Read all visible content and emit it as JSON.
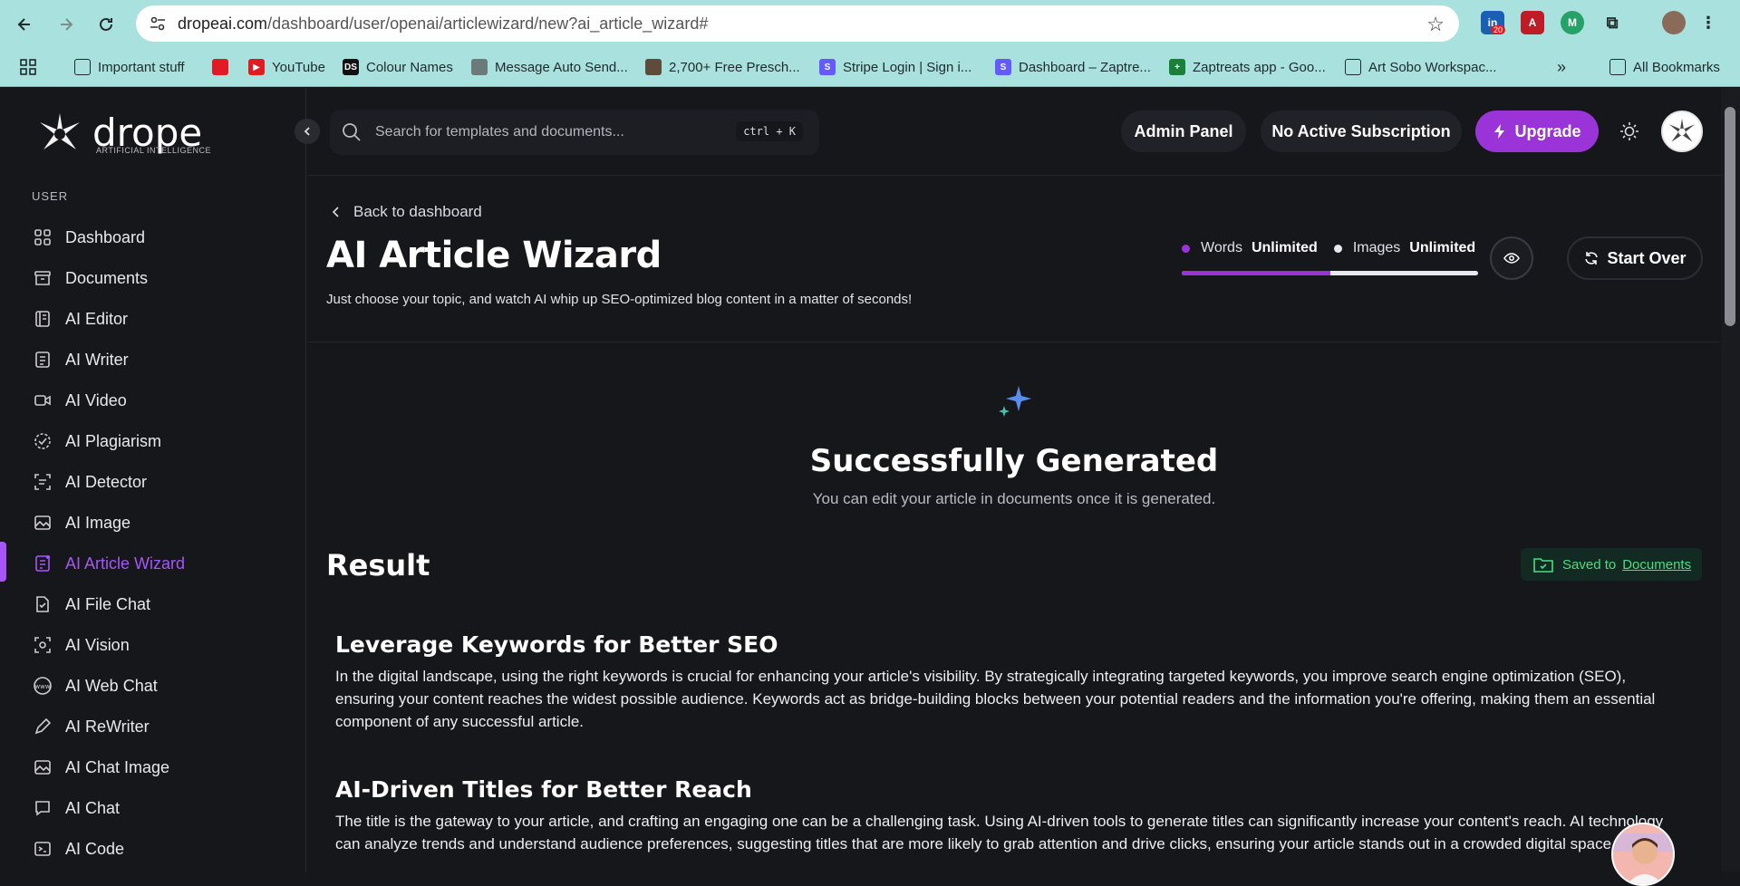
{
  "browser": {
    "url_host": "dropeai.com",
    "url_path": "/dashboard/user/openai/articlewizard/new?ai_article_wizard#",
    "ext_badge": "20",
    "bookmarks": [
      {
        "label": "Important stuff",
        "icon": "folder-icon"
      },
      {
        "label": "",
        "icon": "bookmark-red-icon"
      },
      {
        "label": "YouTube",
        "icon": "youtube-icon"
      },
      {
        "label": "Colour Names",
        "icon": "ds-icon"
      },
      {
        "label": "Message Auto Send...",
        "icon": "message-icon"
      },
      {
        "label": "2,700+ Free Presch...",
        "icon": "image-icon"
      },
      {
        "label": "Stripe Login | Sign i...",
        "icon": "stripe-icon"
      },
      {
        "label": "Dashboard – Zaptre...",
        "icon": "stripe-icon"
      },
      {
        "label": "Zaptreats app - Goo...",
        "icon": "sheets-icon"
      },
      {
        "label": "Art Sobo Workspac...",
        "icon": "mail-icon"
      }
    ],
    "more_bookmarks": "»",
    "all_bookmarks": "All Bookmarks"
  },
  "sidebar": {
    "logo_word": "drope",
    "logo_sub": "ARTIFICIAL INTELLIGENCE",
    "section_label": "USER",
    "items": [
      {
        "label": "Dashboard",
        "icon": "grid-icon"
      },
      {
        "label": "Documents",
        "icon": "archive-icon"
      },
      {
        "label": "AI Editor",
        "icon": "editor-icon"
      },
      {
        "label": "AI Writer",
        "icon": "document-icon"
      },
      {
        "label": "AI Video",
        "icon": "video-icon"
      },
      {
        "label": "AI Plagiarism",
        "icon": "check-circle-icon"
      },
      {
        "label": "AI Detector",
        "icon": "scan-icon"
      },
      {
        "label": "AI Image",
        "icon": "image-icon"
      },
      {
        "label": "AI Article Wizard",
        "icon": "wizard-icon",
        "active": true
      },
      {
        "label": "AI File Chat",
        "icon": "file-chat-icon"
      },
      {
        "label": "AI Vision",
        "icon": "vision-icon"
      },
      {
        "label": "AI Web Chat",
        "icon": "www-icon"
      },
      {
        "label": "AI ReWriter",
        "icon": "pen-icon"
      },
      {
        "label": "AI Chat Image",
        "icon": "chat-image-icon"
      },
      {
        "label": "AI Chat",
        "icon": "chat-icon"
      },
      {
        "label": "AI Code",
        "icon": "code-icon"
      }
    ]
  },
  "header": {
    "search_placeholder": "Search for templates and documents...",
    "search_shortcut": "ctrl + K",
    "admin_panel": "Admin Panel",
    "subscription": "No Active Subscription",
    "upgrade": "Upgrade"
  },
  "page": {
    "back": "Back to dashboard",
    "title": "AI Article Wizard",
    "subtitle": "Just choose your topic, and watch AI whip up SEO-optimized blog content in a matter of seconds!",
    "credits": {
      "words_label": "Words",
      "words_value": "Unlimited",
      "images_label": "Images",
      "images_value": "Unlimited",
      "words_color": "#9b34d8",
      "images_color": "#e8e8ee",
      "words_fraction": 0.5
    },
    "start_over": "Start Over",
    "success_title": "Successfully Generated",
    "success_sub": "You can edit your article in documents once it is generated.",
    "result_title": "Result",
    "saved_prefix": "Saved to",
    "saved_link": "Documents",
    "article": [
      {
        "heading": "Leverage Keywords for Better SEO",
        "body": "In the digital landscape, using the right keywords is crucial for enhancing your article's visibility. By strategically integrating targeted keywords, you improve search engine optimization (SEO), ensuring your content reaches the widest possible audience. Keywords act as bridge-building blocks between your potential readers and the information you're offering, making them an essential component of any successful article."
      },
      {
        "heading": "AI-Driven Titles for Better Reach",
        "body": "The title is the gateway to your article, and crafting an engaging one can be a challenging task. Using AI-driven tools to generate titles can significantly increase your content's reach. AI technology can analyze trends and understand audience preferences, suggesting titles that are more likely to grab attention and drive clicks, ensuring your article stands out in a crowded digital space."
      }
    ]
  },
  "colors": {
    "accent": "#a855f7",
    "upgrade": "#9b34d8",
    "success": "#4ade80",
    "background": "#16171b"
  }
}
